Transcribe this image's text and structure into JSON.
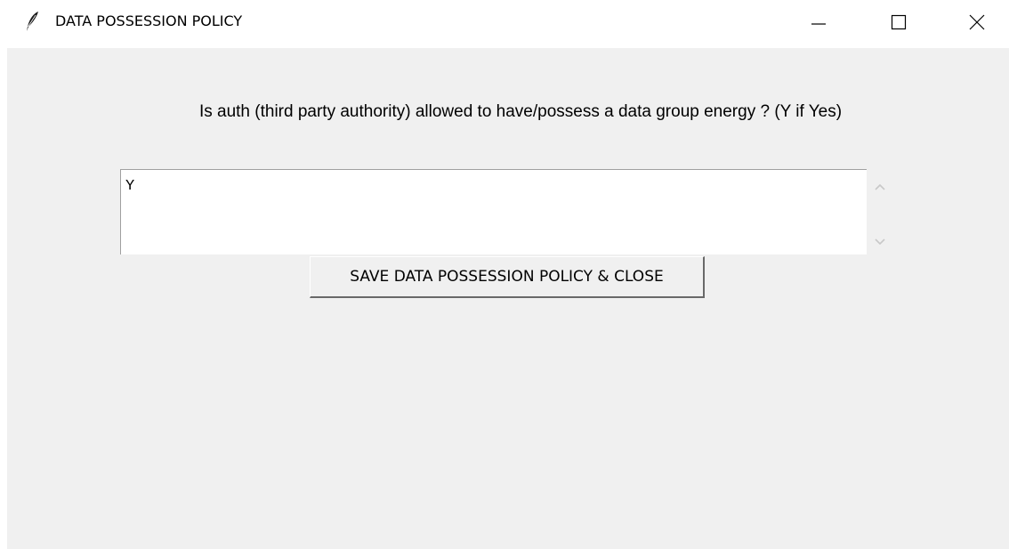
{
  "window": {
    "title": "DATA POSSESSION POLICY",
    "icon": "feather-icon",
    "controls": {
      "minimize_icon": "minimize-icon",
      "maximize_icon": "maximize-icon",
      "close_icon": "close-icon"
    }
  },
  "form": {
    "question": "Is auth (third party authority) allowed to have/possess a data group energy ? (Y if Yes)",
    "answer_value": "Y",
    "save_button_label": "SAVE DATA POSSESSION POLICY & CLOSE"
  },
  "colors": {
    "client_background": "#f0f0f0",
    "titlebar_background": "#ffffff",
    "textbox_background": "#ffffff"
  }
}
